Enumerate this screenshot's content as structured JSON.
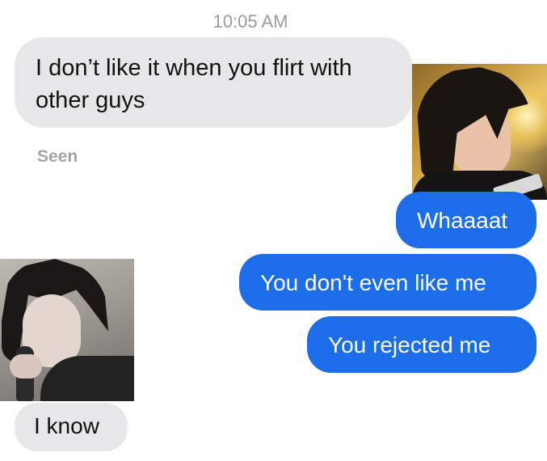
{
  "conversation": {
    "timestamp": "10:05 AM",
    "messages": [
      {
        "direction": "received",
        "text": "I don’t like it when you flirt with other guys"
      },
      {
        "direction": "sent",
        "text": "Whaaaat"
      },
      {
        "direction": "sent",
        "text": "You don't even like me"
      },
      {
        "direction": "sent",
        "text": "You rejected me"
      },
      {
        "direction": "received",
        "text": "I know"
      }
    ],
    "read_receipt": "Seen"
  },
  "colors": {
    "sent_bubble": "#1b6dea",
    "received_bubble": "#e7e7e9",
    "timestamp_text": "#9a9a9a",
    "seen_text": "#a4a4a4"
  },
  "photos": [
    {
      "name": "photo-sticker-right",
      "description_icon": "person-photo"
    },
    {
      "name": "photo-sticker-left",
      "description_icon": "person-photo"
    }
  ]
}
